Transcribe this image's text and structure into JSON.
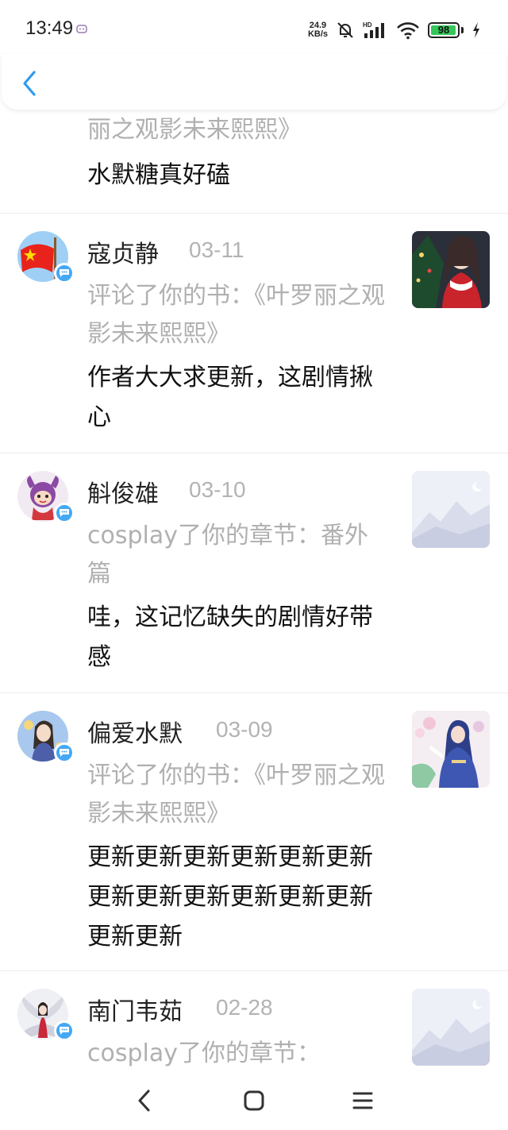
{
  "status_bar": {
    "time": "13:49",
    "net_speed_value": "24.9",
    "net_speed_unit": "KB/s",
    "battery": "98",
    "battery_level": 0.98,
    "icons": [
      "app-notification-icon",
      "mute-icon",
      "hd-signal-icon",
      "wifi-icon",
      "battery-icon",
      "charging-icon"
    ]
  },
  "header": {
    "back_icon": "chevron-left-icon"
  },
  "top_item": {
    "action_tail": "丽之观影未来熙熙》",
    "comment": "水默糖真好磕"
  },
  "items": [
    {
      "name": "寇贞静",
      "date": "03-11",
      "action": "评论了你的书：《叶罗丽之观影未来熙熙》",
      "comment": "作者大大求更新，这剧情揪心",
      "avatar": "red-flag-avatar",
      "thumb": "girl-christmas-thumbnail"
    },
    {
      "name": "斛俊雄",
      "date": "03-10",
      "action": "cosplay了你的章节：番外篇",
      "comment": "哇，这记忆缺失的剧情好带感",
      "avatar": "cartoon-mascot-avatar",
      "thumb": "placeholder-mountain-thumbnail"
    },
    {
      "name": "偏爱水默",
      "date": "03-09",
      "action": "评论了你的书：《叶罗丽之观影未来熙熙》",
      "comment": "更新更新更新更新更新更新更新更新更新更新更新更新更新更新",
      "avatar": "anime-girl-avatar",
      "thumb": "anime-boy-thumbnail"
    },
    {
      "name": "南门韦茹",
      "date": "02-28",
      "action": "cosplay了你的章节：",
      "comment": "",
      "avatar": "nine-tail-fox-avatar",
      "thumb": "placeholder-mountain-thumbnail"
    }
  ],
  "nav_bar": {
    "back": "nav-back-icon",
    "home": "nav-home-icon",
    "menu": "nav-menu-icon"
  },
  "colors": {
    "badge": "#44a8f5",
    "back_arrow": "#2e9bf0",
    "muted_text": "#b0b0b0",
    "divider": "#ececec"
  }
}
